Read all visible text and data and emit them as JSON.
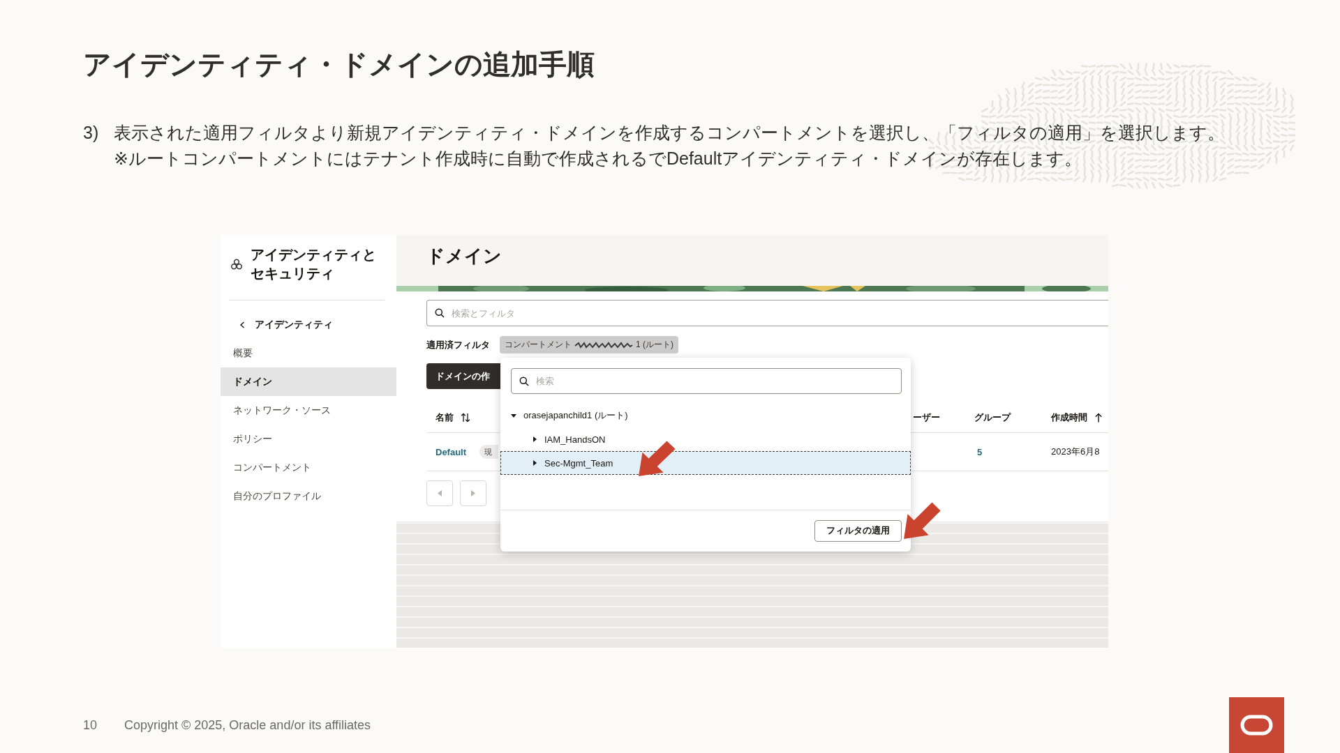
{
  "slide": {
    "title": "アイデンティティ・ドメインの追加手順",
    "step": {
      "number": "3)",
      "lines": [
        "表示された適用フィルタより新規アイデンティティ・ドメインを作成するコンパートメントを選択し、「フィルタの適用」を選択します。",
        "※ルートコンパートメントにはテナント作成時に自動で作成されるでDefaultアイデンティティ・ドメインが存在します。"
      ]
    }
  },
  "console": {
    "sidebar": {
      "title": "アイデンティティとセキュリティ",
      "back_link": "アイデンティティ",
      "items": [
        {
          "label": "概要",
          "selected": false
        },
        {
          "label": "ドメイン",
          "selected": true
        },
        {
          "label": "ネットワーク・ソース",
          "selected": false
        },
        {
          "label": "ポリシー",
          "selected": false
        },
        {
          "label": "コンパートメント",
          "selected": false
        },
        {
          "label": "自分のプロファイル",
          "selected": false
        }
      ]
    },
    "page_title": "ドメイン",
    "search": {
      "placeholder": "検索とフィルタ"
    },
    "applied_filters": {
      "label": "適用済フィルタ",
      "chip_prefix": "コンパートメント",
      "chip_suffix": "1 (ルート)"
    },
    "create_button": "ドメインの作",
    "table": {
      "columns": [
        {
          "label": "名前",
          "sortable": true,
          "sorted": false
        },
        {
          "label": "ーザー"
        },
        {
          "label": "グループ"
        },
        {
          "label": "作成時間",
          "sortable": true,
          "sorted": true
        }
      ],
      "rows": [
        {
          "name": "Default",
          "badge": "現",
          "groups": "5",
          "created": "2023年6月8"
        }
      ]
    }
  },
  "filter_popup": {
    "search_placeholder": "検索",
    "tree": [
      {
        "label": "orasejapanchild1 (ルート)",
        "expanded": true,
        "selected": false,
        "children": [
          {
            "label": "IAM_HandsON",
            "expanded": false,
            "selected": false
          },
          {
            "label": "Sec-Mgmt_Team",
            "expanded": false,
            "selected": true
          }
        ]
      }
    ],
    "apply_button": "フィルタの適用"
  },
  "footer": {
    "page_number": "10",
    "copyright": "Copyright © 2025, Oracle and/or its affiliates"
  }
}
